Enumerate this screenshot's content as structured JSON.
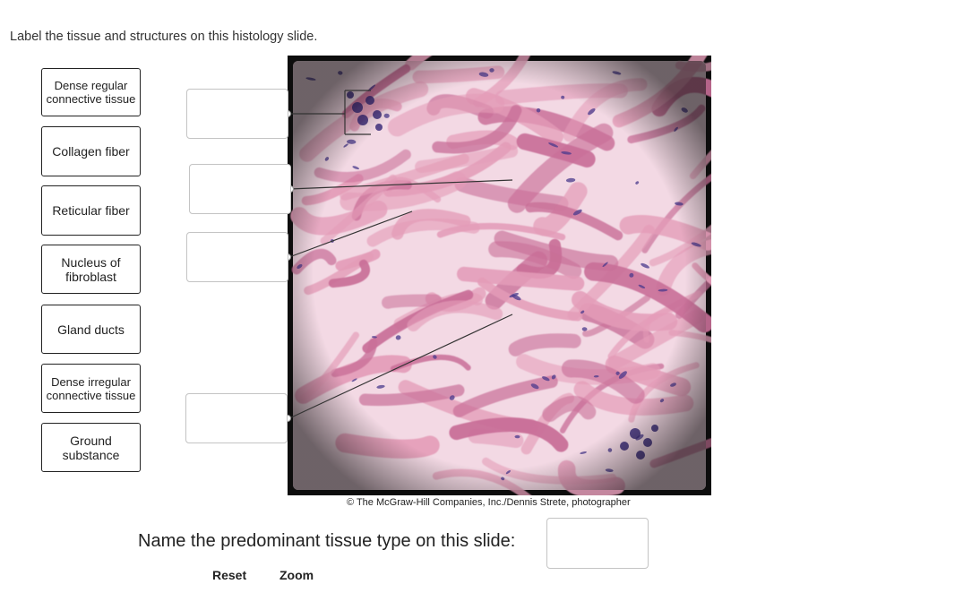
{
  "instruction": "Label the tissue and structures on this histology slide.",
  "labels": [
    "Dense regular connective tissue",
    "Collagen fiber",
    "Reticular fiber",
    "Nucleus of fibroblast",
    "Gland ducts",
    "Dense irregular connective tissue",
    "Ground substance"
  ],
  "drop_targets": [
    "",
    "",
    "",
    ""
  ],
  "slide": {
    "credit": "© The McGraw-Hill Companies, Inc./Dennis Strete, photographer",
    "colors": {
      "background": "#f3d9e4",
      "fiber": "#e49cb8",
      "fiber_dark": "#c96f98",
      "nucleus": "#4a3a8c",
      "border": "#0d0d0d"
    }
  },
  "question": {
    "text": "Name the predominant tissue type on this slide:",
    "answer": ""
  },
  "actions": {
    "reset": "Reset",
    "zoom": "Zoom"
  }
}
